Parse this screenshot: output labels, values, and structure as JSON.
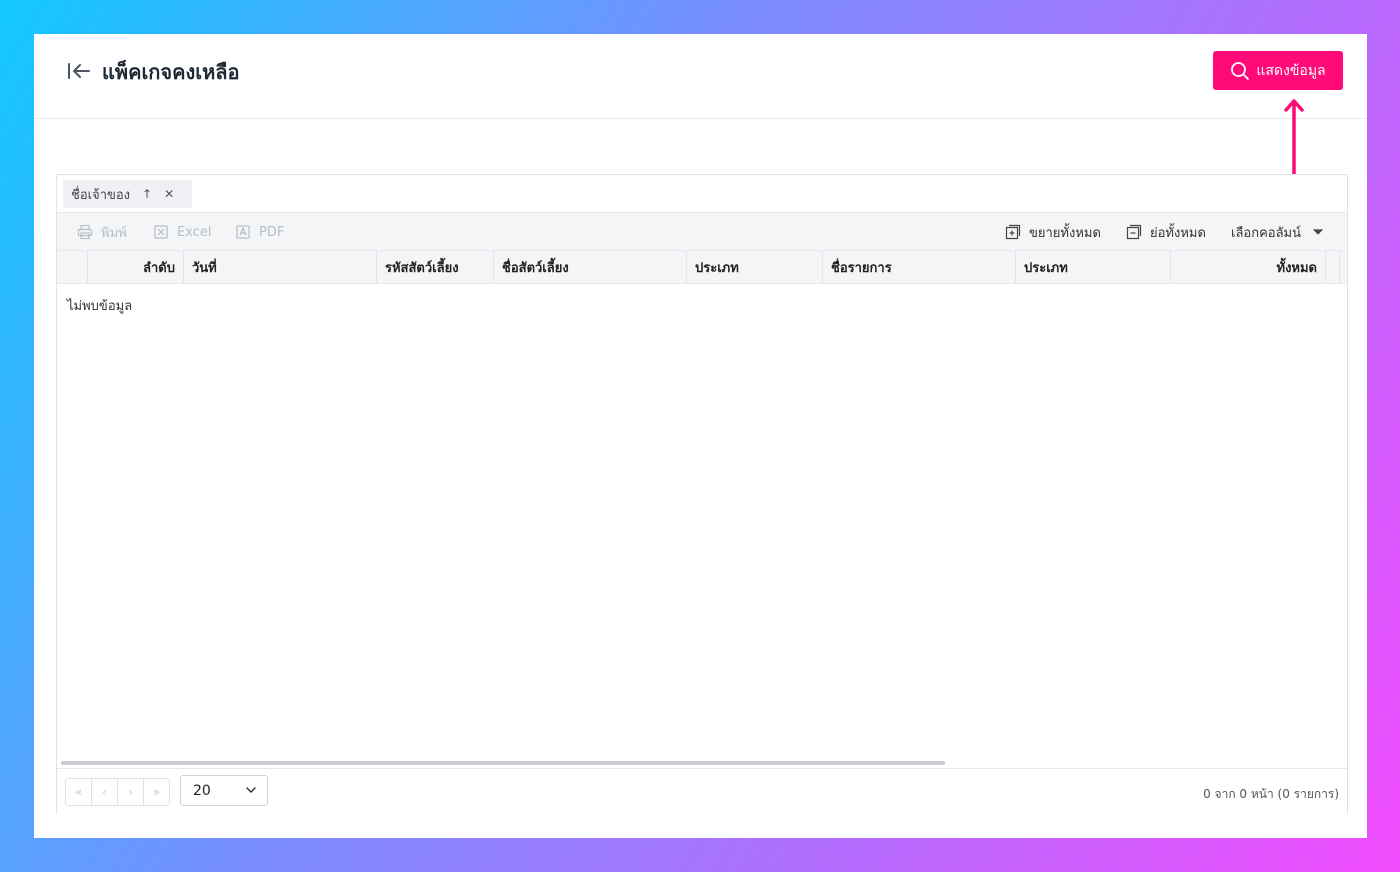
{
  "header": {
    "title": "แพ็คเกจคงเหลือ",
    "back_icon": "arrow-left-to-line-icon",
    "show_button_label": "แสดงข้อมูล",
    "show_button_icon": "search-icon",
    "accent_color": "#ff0a78"
  },
  "grid": {
    "group_chip": {
      "label": "ชื่อเจ้าของ",
      "sort_icon": "arrow-up-icon",
      "remove_icon": "close-icon"
    },
    "toolbar": {
      "print_label": "พิมพ์",
      "excel_label": "Excel",
      "pdf_label": "PDF",
      "expand_all_label": "ขยายทั้งหมด",
      "collapse_all_label": "ย่อทั้งหมด",
      "column_chooser_label": "เลือกคอลัมน์"
    },
    "columns": [
      "ลำดับ",
      "วันที่",
      "รหัสสัตว์เลี้ยง",
      "ชื่อสัตว์เลี้ยง",
      "ประเภท",
      "ชื่อรายการ",
      "ประเภท",
      "ทั้งหมด"
    ],
    "no_data_text": "ไม่พบข้อมูล",
    "footer": {
      "page_size": "20",
      "page_info": "0 จาก 0 หน้า (0 รายการ)"
    }
  }
}
